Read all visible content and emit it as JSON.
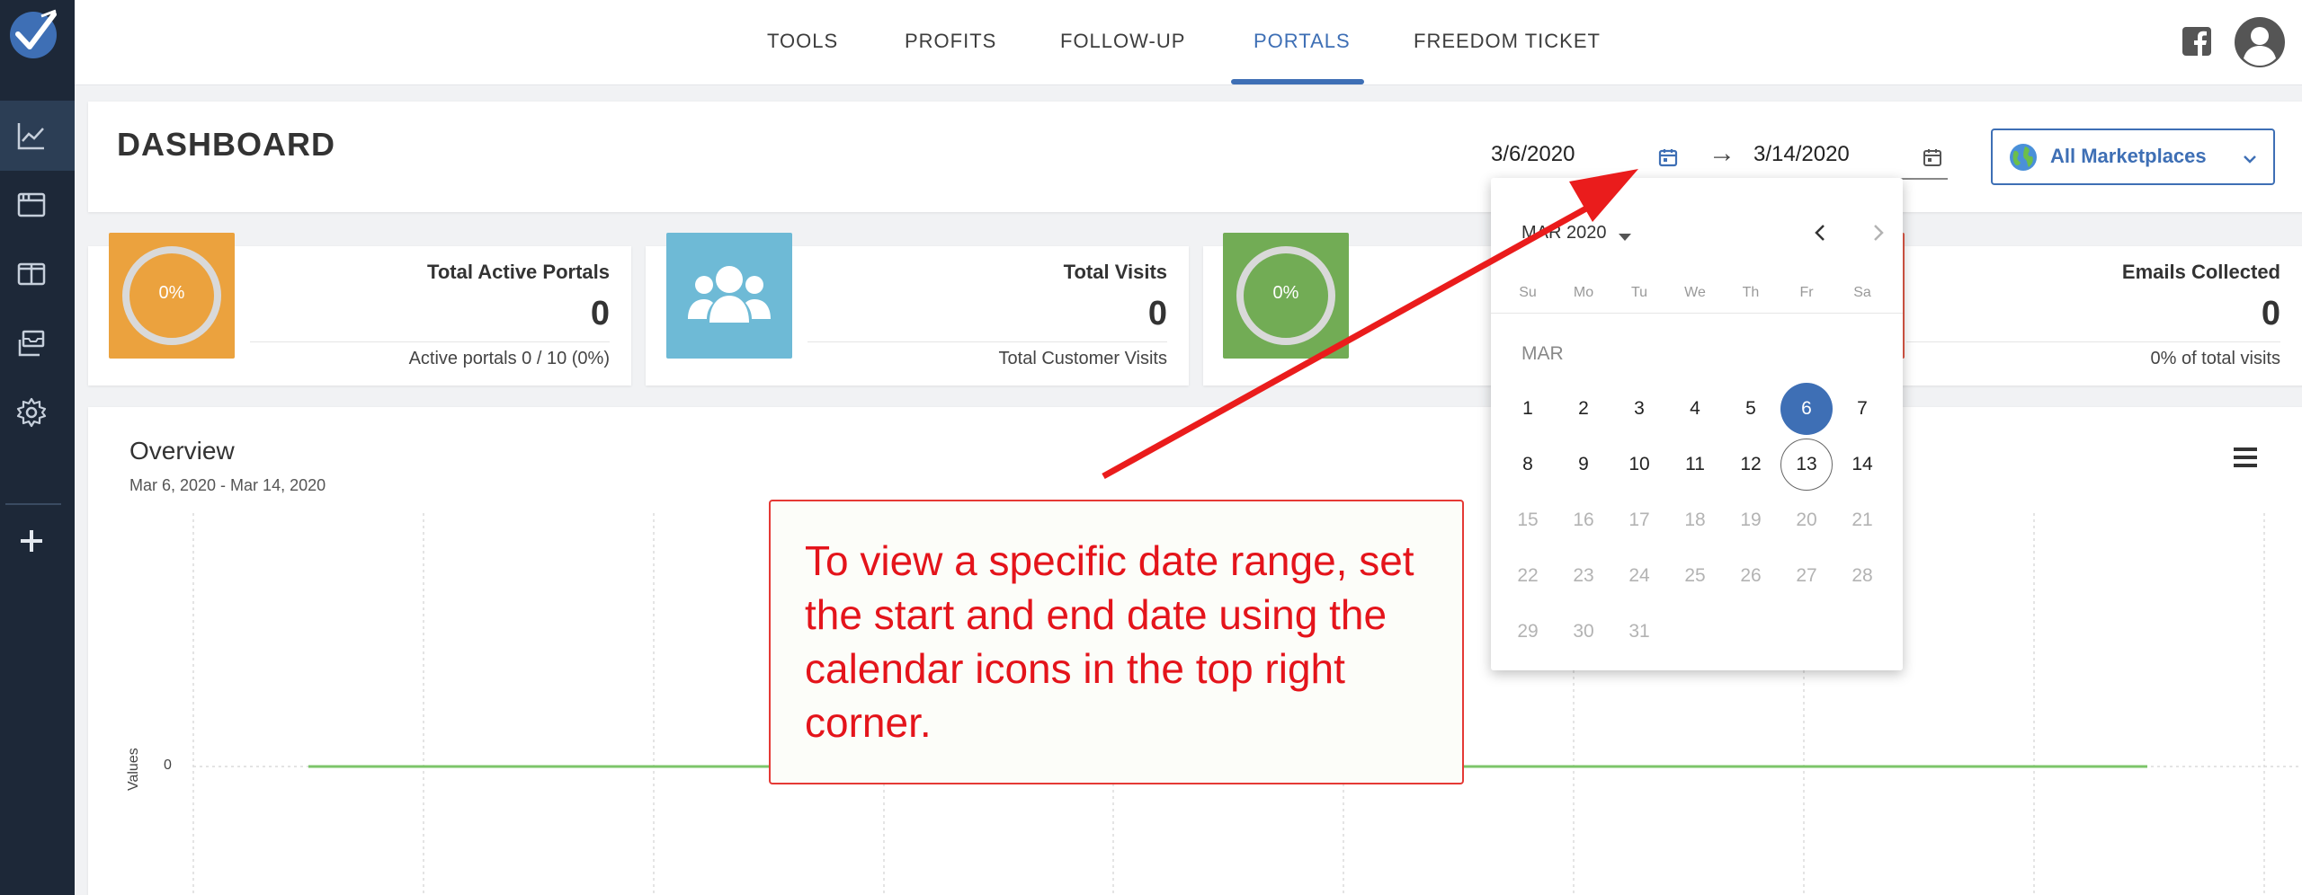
{
  "nav": {
    "items": [
      {
        "label": "TOOLS"
      },
      {
        "label": "PROFITS"
      },
      {
        "label": "FOLLOW-UP"
      },
      {
        "label": "PORTALS"
      },
      {
        "label": "FREEDOM TICKET"
      }
    ],
    "active": "PORTALS"
  },
  "sidebar": {
    "items": [
      {
        "icon": "chart-line-icon",
        "active": true
      },
      {
        "icon": "browser-window-icon"
      },
      {
        "icon": "book-open-icon"
      },
      {
        "icon": "inbox-stack-icon"
      },
      {
        "icon": "gear-icon"
      },
      {
        "icon": "plus-icon"
      }
    ]
  },
  "dashboard": {
    "title": "DASHBOARD",
    "start_date": "3/6/2020",
    "end_date": "3/14/2020",
    "arrow": "→",
    "marketplace": "All Marketplaces"
  },
  "stats": [
    {
      "title": "Total Active Portals",
      "value": "0",
      "sub": "Active portals 0 / 10 (0%)",
      "tile": "0%",
      "color": "#eba23e"
    },
    {
      "title": "Total Visits",
      "value": "0",
      "sub": "Total Customer Visits",
      "tile": "users-icon",
      "color": "#6ebad6"
    },
    {
      "title": "",
      "value": "",
      "sub": "",
      "tile": "0%",
      "color": "#72ac55"
    },
    {
      "title": "Emails Collected",
      "value": "0",
      "sub": "0% of total visits",
      "tile": "",
      "color": "#e05a48"
    }
  ],
  "overview": {
    "title": "Overview",
    "range": "Mar 6, 2020 - Mar 14, 2020",
    "ylabel": "Values",
    "ytick": "0"
  },
  "picker": {
    "header": "MAR 2020",
    "month_label": "MAR",
    "weekdays": [
      "Su",
      "Mo",
      "Tu",
      "We",
      "Th",
      "Fr",
      "Sa"
    ],
    "rows": [
      [
        "1",
        "2",
        "3",
        "4",
        "5",
        "6",
        "7"
      ],
      [
        "8",
        "9",
        "10",
        "11",
        "12",
        "13",
        "14"
      ],
      [
        "15",
        "16",
        "17",
        "18",
        "19",
        "20",
        "21"
      ],
      [
        "22",
        "23",
        "24",
        "25",
        "26",
        "27",
        "28"
      ],
      [
        "29",
        "30",
        "31"
      ]
    ],
    "selected_day": "6",
    "today_day": "13"
  },
  "annotation": {
    "text": "To view a specific date range, set the start and end date using the calendar icons in the top right corner."
  },
  "colors": {
    "accent": "#3e6fb5",
    "sidebar": "#1d2838",
    "annotation": "#e4141b",
    "chart_line": "#7cc56a"
  }
}
